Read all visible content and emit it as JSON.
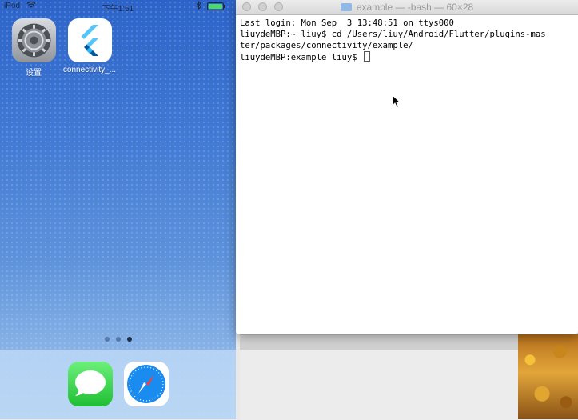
{
  "ios": {
    "status": {
      "carrier": "iPod",
      "time": "下午1:51"
    },
    "apps": [
      {
        "label": "设置"
      },
      {
        "label": "connectivity_..."
      }
    ],
    "dock": [
      "messages-icon",
      "safari-icon"
    ],
    "page_dots": {
      "count": 3,
      "active": 3
    }
  },
  "terminal": {
    "title": "example — -bash — 60×28",
    "lines": [
      "Last login: Mon Sep  3 13:48:51 on ttys000",
      "liuydeMBP:~ liuy$ cd /Users/liuy/Android/Flutter/plugins-mas",
      "ter/packages/connectivity/example/",
      "liuydeMBP:example liuy$ "
    ]
  },
  "colors": {
    "wallpaper": "#3f78d4",
    "flutter_blue": "#3ec2f3",
    "battery": "#4cd964"
  }
}
